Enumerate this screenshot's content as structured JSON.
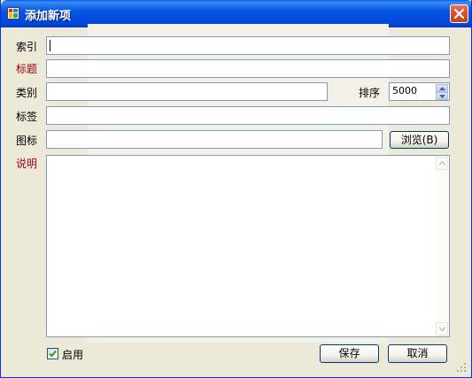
{
  "window": {
    "title": "添加新项"
  },
  "form": {
    "index_label": "索引",
    "index_value": "",
    "title_label": "标题",
    "title_value": "",
    "category_label": "类别",
    "category_value": "",
    "sort_label": "排序",
    "sort_value": "5000",
    "tags_label": "标签",
    "tags_value": "",
    "icon_label": "图标",
    "icon_value": "",
    "browse_label": "浏览(B)",
    "description_label": "说明",
    "description_value": "",
    "enabled_label": "启用",
    "enabled_checked": true
  },
  "buttons": {
    "save_label": "保存",
    "cancel_label": "取消"
  },
  "colors": {
    "required_label": "#a0000a",
    "titlebar": "#0054e3",
    "close_button": "#d9502c",
    "dialog_background": "#ece9d8"
  },
  "icons": {
    "app": "app-window-icon",
    "close": "close-icon",
    "spin_up": "chevron-up-icon",
    "spin_down": "chevron-down-icon",
    "scroll_up": "scroll-up-arrow-icon",
    "scroll_down": "scroll-down-arrow-icon",
    "check": "checkmark-icon",
    "grip": "resize-grip-icon"
  }
}
